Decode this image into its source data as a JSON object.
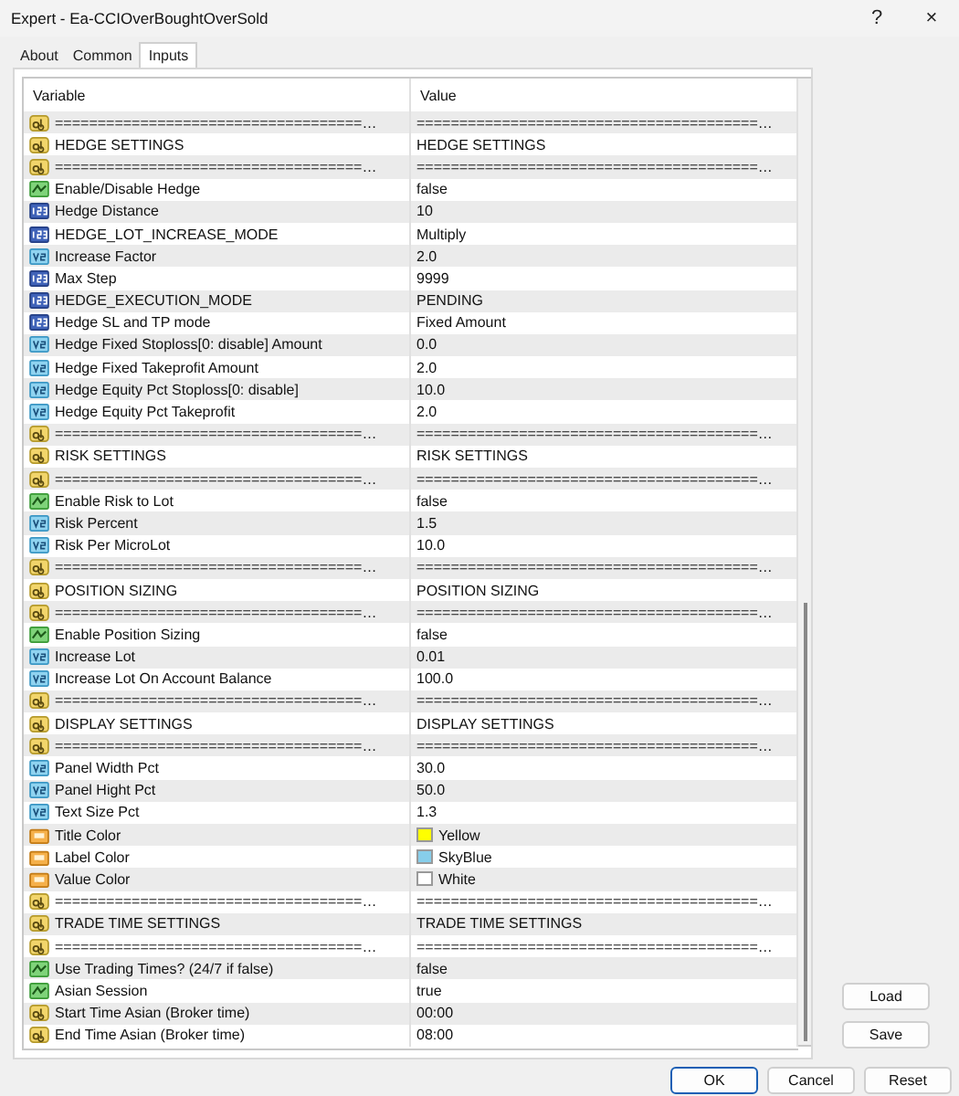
{
  "window": {
    "title": "Expert - Ea-CCIOverBoughtOverSold",
    "help": "?",
    "close": "×"
  },
  "tabs": [
    {
      "label": "About",
      "selected": false
    },
    {
      "label": "Common",
      "selected": false
    },
    {
      "label": "Inputs",
      "selected": true
    }
  ],
  "table": {
    "columns": [
      "Variable",
      "Value"
    ],
    "rows": [
      {
        "kind": "string",
        "variable": "====================================…",
        "value": "========================================…"
      },
      {
        "kind": "string",
        "variable": "HEDGE SETTINGS",
        "value": "HEDGE SETTINGS"
      },
      {
        "kind": "string",
        "variable": "====================================…",
        "value": "========================================…"
      },
      {
        "kind": "bool",
        "variable": "Enable/Disable Hedge",
        "value": "false"
      },
      {
        "kind": "enum",
        "variable": "Hedge Distance",
        "value": "10"
      },
      {
        "kind": "enum",
        "variable": "HEDGE_LOT_INCREASE_MODE",
        "value": "Multiply"
      },
      {
        "kind": "double",
        "variable": "Increase Factor",
        "value": "2.0"
      },
      {
        "kind": "enum",
        "variable": "Max Step",
        "value": "9999"
      },
      {
        "kind": "enum",
        "variable": "HEDGE_EXECUTION_MODE",
        "value": "PENDING"
      },
      {
        "kind": "enum",
        "variable": "Hedge SL and TP mode",
        "value": "Fixed Amount"
      },
      {
        "kind": "double",
        "variable": "Hedge Fixed Stoploss[0: disable] Amount",
        "value": "0.0"
      },
      {
        "kind": "double",
        "variable": "Hedge Fixed Takeprofit Amount",
        "value": "2.0"
      },
      {
        "kind": "double",
        "variable": "Hedge Equity Pct Stoploss[0: disable]",
        "value": "10.0"
      },
      {
        "kind": "double",
        "variable": "Hedge Equity Pct Takeprofit",
        "value": "2.0"
      },
      {
        "kind": "string",
        "variable": "====================================…",
        "value": "========================================…"
      },
      {
        "kind": "string",
        "variable": "RISK SETTINGS",
        "value": "RISK SETTINGS"
      },
      {
        "kind": "string",
        "variable": "====================================…",
        "value": "========================================…"
      },
      {
        "kind": "bool",
        "variable": "Enable Risk to Lot",
        "value": "false"
      },
      {
        "kind": "double",
        "variable": "Risk Percent",
        "value": "1.5"
      },
      {
        "kind": "double",
        "variable": "Risk Per MicroLot",
        "value": "10.0"
      },
      {
        "kind": "string",
        "variable": "====================================…",
        "value": "========================================…"
      },
      {
        "kind": "string",
        "variable": "POSITION SIZING",
        "value": "POSITION SIZING"
      },
      {
        "kind": "string",
        "variable": "====================================…",
        "value": "========================================…"
      },
      {
        "kind": "bool",
        "variable": "Enable Position Sizing",
        "value": "false"
      },
      {
        "kind": "double",
        "variable": "Increase Lot",
        "value": "0.01"
      },
      {
        "kind": "double",
        "variable": "Increase Lot On Account Balance",
        "value": "100.0"
      },
      {
        "kind": "string",
        "variable": "====================================…",
        "value": "========================================…"
      },
      {
        "kind": "string",
        "variable": "DISPLAY SETTINGS",
        "value": "DISPLAY SETTINGS"
      },
      {
        "kind": "string",
        "variable": "====================================…",
        "value": "========================================…"
      },
      {
        "kind": "double",
        "variable": "Panel Width Pct",
        "value": "30.0"
      },
      {
        "kind": "double",
        "variable": "Panel Hight Pct",
        "value": "50.0"
      },
      {
        "kind": "double",
        "variable": "Text Size Pct",
        "value": "1.3"
      },
      {
        "kind": "color",
        "variable": "Title Color",
        "value": "Yellow",
        "color": "#ffff00"
      },
      {
        "kind": "color",
        "variable": "Label Color",
        "value": "SkyBlue",
        "color": "#87ceeb"
      },
      {
        "kind": "color",
        "variable": "Value Color",
        "value": "White",
        "color": "#ffffff"
      },
      {
        "kind": "string",
        "variable": "====================================…",
        "value": "========================================…"
      },
      {
        "kind": "string",
        "variable": "TRADE TIME SETTINGS",
        "value": "TRADE TIME SETTINGS"
      },
      {
        "kind": "string",
        "variable": "====================================…",
        "value": "========================================…"
      },
      {
        "kind": "bool",
        "variable": "Use Trading Times? (24/7 if false)",
        "value": "false"
      },
      {
        "kind": "bool",
        "variable": "Asian Session",
        "value": "true"
      },
      {
        "kind": "string",
        "variable": "Start Time Asian (Broker time)",
        "value": "00:00"
      },
      {
        "kind": "string",
        "variable": "End Time Asian (Broker time)",
        "value": "08:00"
      }
    ]
  },
  "side_buttons": [
    "Load",
    "Save"
  ],
  "buttons": [
    "OK",
    "Cancel",
    "Reset"
  ]
}
